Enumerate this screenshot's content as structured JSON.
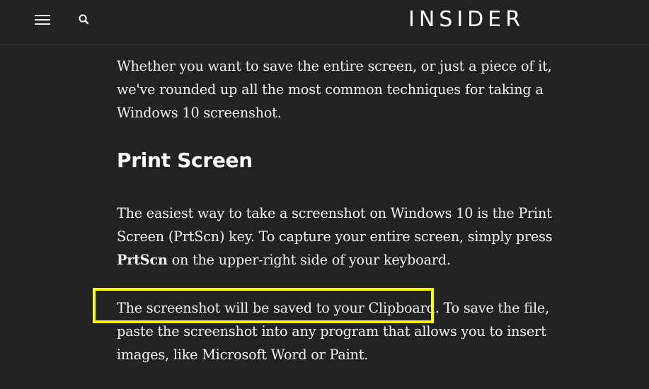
{
  "header": {
    "menu_icon": "hamburger-menu-icon",
    "search_icon": "search-icon",
    "logo_text": "INSIDER"
  },
  "article": {
    "intro": {
      "lines": [
        "Whether you want to save the entire screen, or just a piece of it,",
        "we've rounded up all the most common techniques for taking a",
        "Windows 10 screenshot."
      ]
    },
    "section_heading": "Print Screen",
    "paragraph_2": {
      "line1": "The easiest way to take a screenshot on Windows 10 is the Print",
      "line2": "Screen (PrtScn) key. To capture your entire screen, simply press",
      "bold": "PrtScn",
      "line3_rest": " on the upper-right side of your keyboard."
    },
    "paragraph_3": {
      "highlighted": "The screenshot will be saved to your Clipboard.",
      "line1_rest": " To save the file,",
      "line2": "paste the screenshot into any program that allows you to insert",
      "line3": "images, like Microsoft Word or Paint."
    }
  },
  "highlight": {
    "color": "#ffff00"
  },
  "colors": {
    "background": "#222222",
    "text": "#f2f2f2"
  }
}
